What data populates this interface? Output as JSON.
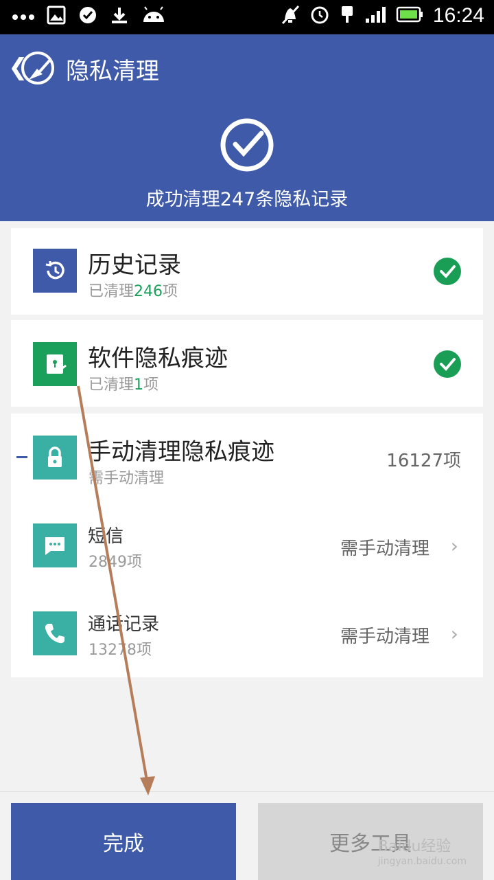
{
  "status_bar": {
    "time": "16:24"
  },
  "header": {
    "title": "隐私清理",
    "result": "成功清理247条隐私记录"
  },
  "items": [
    {
      "title": "历史记录",
      "prefix": "已清理",
      "count": "246",
      "suffix": "项"
    },
    {
      "title": "软件隐私痕迹",
      "prefix": "已清理",
      "count": "1",
      "suffix": "项"
    }
  ],
  "manual": {
    "title": "手动清理隐私痕迹",
    "subtitle": "需手动清理",
    "total": "16127项",
    "subitems": [
      {
        "title": "短信",
        "count": "2849项",
        "status": "需手动清理"
      },
      {
        "title": "通话记录",
        "count": "13278项",
        "status": "需手动清理"
      }
    ]
  },
  "buttons": {
    "done": "完成",
    "more": "更多工具"
  },
  "watermark": {
    "line1": "Baidu经验",
    "line2": "jingyan.baidu.com"
  },
  "colors": {
    "brand": "#3f5aa8",
    "success": "#1a9e55",
    "teal": "#3aafa4",
    "arrow": "#b57d5a"
  }
}
